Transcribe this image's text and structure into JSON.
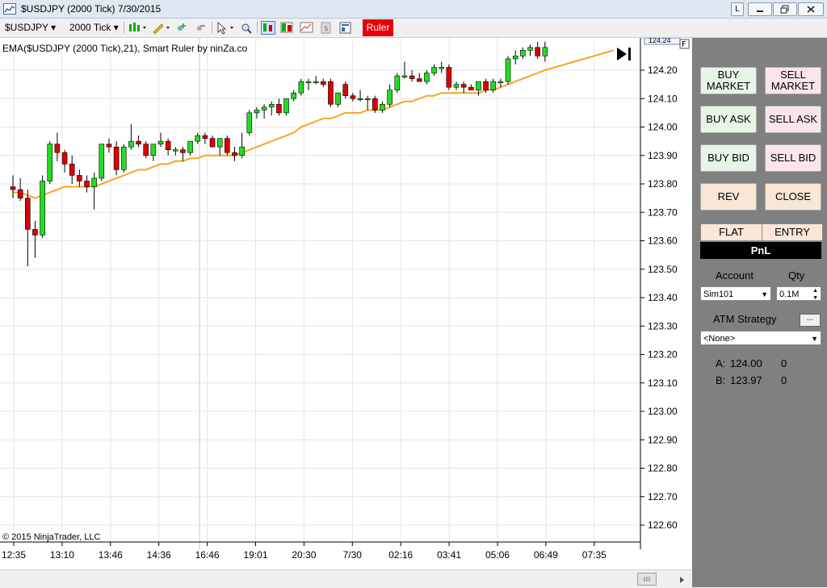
{
  "window": {
    "title": "$USDJPY (2000 Tick)  7/30/2015",
    "btn_l": "L"
  },
  "toolbar": {
    "instrument": "$USDJPY",
    "interval": "2000 Tick",
    "ruler_label": "Ruler"
  },
  "chart": {
    "indicator_label": "EMA($USDJPY (2000 Tick),21), Smart Ruler by ninZa.co",
    "copyright": "© 2015 NinjaTrader, LLC",
    "price_labels": [
      "124.20",
      "124.10",
      "124.00",
      "123.90",
      "123.80",
      "123.70",
      "123.60",
      "123.50",
      "123.40",
      "123.30",
      "123.20",
      "123.10",
      "123.00",
      "122.90",
      "122.80",
      "122.70",
      "122.60"
    ],
    "time_labels": [
      "12:35",
      "13:10",
      "13:46",
      "14:36",
      "16:46",
      "19:01",
      "20:30",
      "7/30",
      "02:16",
      "03:41",
      "05:06",
      "06:49",
      "07:35"
    ],
    "current_price": "124.24",
    "colors": {
      "up": "#22dd22",
      "down": "#dd0000",
      "ema": "#f5a623"
    },
    "candles": [
      {
        "o": 123.79,
        "h": 123.83,
        "l": 123.75,
        "c": 123.78
      },
      {
        "o": 123.78,
        "h": 123.82,
        "l": 123.74,
        "c": 123.75
      },
      {
        "o": 123.75,
        "h": 123.78,
        "l": 123.51,
        "c": 123.64
      },
      {
        "o": 123.64,
        "h": 123.67,
        "l": 123.54,
        "c": 123.62
      },
      {
        "o": 123.62,
        "h": 123.83,
        "l": 123.61,
        "c": 123.81
      },
      {
        "o": 123.81,
        "h": 123.95,
        "l": 123.8,
        "c": 123.94
      },
      {
        "o": 123.94,
        "h": 123.98,
        "l": 123.88,
        "c": 123.91
      },
      {
        "o": 123.91,
        "h": 123.92,
        "l": 123.84,
        "c": 123.87
      },
      {
        "o": 123.87,
        "h": 123.9,
        "l": 123.8,
        "c": 123.83
      },
      {
        "o": 123.83,
        "h": 123.85,
        "l": 123.79,
        "c": 123.81
      },
      {
        "o": 123.81,
        "h": 123.83,
        "l": 123.77,
        "c": 123.79
      },
      {
        "o": 123.79,
        "h": 123.84,
        "l": 123.71,
        "c": 123.82
      },
      {
        "o": 123.82,
        "h": 123.94,
        "l": 123.81,
        "c": 123.94
      },
      {
        "o": 123.94,
        "h": 123.96,
        "l": 123.91,
        "c": 123.93
      },
      {
        "o": 123.93,
        "h": 123.95,
        "l": 123.83,
        "c": 123.85
      },
      {
        "o": 123.85,
        "h": 123.94,
        "l": 123.84,
        "c": 123.93
      },
      {
        "o": 123.93,
        "h": 124.01,
        "l": 123.92,
        "c": 123.95
      },
      {
        "o": 123.95,
        "h": 123.97,
        "l": 123.93,
        "c": 123.94
      },
      {
        "o": 123.94,
        "h": 123.95,
        "l": 123.89,
        "c": 123.9
      },
      {
        "o": 123.9,
        "h": 123.94,
        "l": 123.88,
        "c": 123.94
      },
      {
        "o": 123.94,
        "h": 123.98,
        "l": 123.93,
        "c": 123.95
      },
      {
        "o": 123.95,
        "h": 123.96,
        "l": 123.9,
        "c": 123.92
      },
      {
        "o": 123.92,
        "h": 123.93,
        "l": 123.9,
        "c": 123.92
      },
      {
        "o": 123.92,
        "h": 123.93,
        "l": 123.88,
        "c": 123.91
      },
      {
        "o": 123.91,
        "h": 123.95,
        "l": 123.9,
        "c": 123.95
      },
      {
        "o": 123.95,
        "h": 123.98,
        "l": 123.94,
        "c": 123.97
      },
      {
        "o": 123.97,
        "h": 123.98,
        "l": 123.94,
        "c": 123.96
      },
      {
        "o": 123.96,
        "h": 123.97,
        "l": 123.93,
        "c": 123.93
      },
      {
        "o": 123.93,
        "h": 123.96,
        "l": 123.9,
        "c": 123.96
      },
      {
        "o": 123.96,
        "h": 123.97,
        "l": 123.9,
        "c": 123.91
      },
      {
        "o": 123.91,
        "h": 123.93,
        "l": 123.88,
        "c": 123.9
      },
      {
        "o": 123.9,
        "h": 123.98,
        "l": 123.89,
        "c": 123.93
      },
      {
        "o": 123.98,
        "h": 124.06,
        "l": 123.97,
        "c": 124.05
      },
      {
        "o": 124.05,
        "h": 124.07,
        "l": 124.03,
        "c": 124.06
      },
      {
        "o": 124.06,
        "h": 124.08,
        "l": 124.03,
        "c": 124.07
      },
      {
        "o": 124.07,
        "h": 124.09,
        "l": 124.04,
        "c": 124.08
      },
      {
        "o": 124.08,
        "h": 124.1,
        "l": 124.04,
        "c": 124.05
      },
      {
        "o": 124.05,
        "h": 124.1,
        "l": 124.04,
        "c": 124.1
      },
      {
        "o": 124.1,
        "h": 124.13,
        "l": 124.09,
        "c": 124.12
      },
      {
        "o": 124.12,
        "h": 124.17,
        "l": 124.11,
        "c": 124.16
      },
      {
        "o": 124.16,
        "h": 124.17,
        "l": 124.13,
        "c": 124.16
      },
      {
        "o": 124.16,
        "h": 124.18,
        "l": 124.15,
        "c": 124.16
      },
      {
        "o": 124.16,
        "h": 124.17,
        "l": 124.14,
        "c": 124.15
      },
      {
        "o": 124.16,
        "h": 124.17,
        "l": 124.07,
        "c": 124.08
      },
      {
        "o": 124.08,
        "h": 124.12,
        "l": 124.07,
        "c": 124.12
      },
      {
        "o": 124.15,
        "h": 124.16,
        "l": 124.1,
        "c": 124.11
      },
      {
        "o": 124.11,
        "h": 124.12,
        "l": 124.09,
        "c": 124.1
      },
      {
        "o": 124.1,
        "h": 124.13,
        "l": 124.09,
        "c": 124.1
      },
      {
        "o": 124.1,
        "h": 124.11,
        "l": 124.06,
        "c": 124.1
      },
      {
        "o": 124.1,
        "h": 124.11,
        "l": 124.05,
        "c": 124.06
      },
      {
        "o": 124.06,
        "h": 124.09,
        "l": 124.05,
        "c": 124.08
      },
      {
        "o": 124.08,
        "h": 124.15,
        "l": 124.07,
        "c": 124.13
      },
      {
        "o": 124.13,
        "h": 124.19,
        "l": 124.12,
        "c": 124.18
      },
      {
        "o": 124.18,
        "h": 124.23,
        "l": 124.17,
        "c": 124.18
      },
      {
        "o": 124.18,
        "h": 124.2,
        "l": 124.16,
        "c": 124.17
      },
      {
        "o": 124.17,
        "h": 124.19,
        "l": 124.16,
        "c": 124.16
      },
      {
        "o": 124.16,
        "h": 124.2,
        "l": 124.15,
        "c": 124.19
      },
      {
        "o": 124.19,
        "h": 124.22,
        "l": 124.18,
        "c": 124.21
      },
      {
        "o": 124.21,
        "h": 124.23,
        "l": 124.19,
        "c": 124.21
      },
      {
        "o": 124.21,
        "h": 124.22,
        "l": 124.13,
        "c": 124.14
      },
      {
        "o": 124.14,
        "h": 124.16,
        "l": 124.13,
        "c": 124.15
      },
      {
        "o": 124.15,
        "h": 124.16,
        "l": 124.12,
        "c": 124.14
      },
      {
        "o": 124.14,
        "h": 124.15,
        "l": 124.13,
        "c": 124.13
      },
      {
        "o": 124.13,
        "h": 124.16,
        "l": 124.11,
        "c": 124.16
      },
      {
        "o": 124.16,
        "h": 124.17,
        "l": 124.12,
        "c": 124.13
      },
      {
        "o": 124.13,
        "h": 124.17,
        "l": 124.12,
        "c": 124.16
      },
      {
        "o": 124.16,
        "h": 124.17,
        "l": 124.14,
        "c": 124.16
      },
      {
        "o": 124.16,
        "h": 124.25,
        "l": 124.15,
        "c": 124.24
      },
      {
        "o": 124.24,
        "h": 124.27,
        "l": 124.22,
        "c": 124.25
      },
      {
        "o": 124.25,
        "h": 124.28,
        "l": 124.24,
        "c": 124.27
      },
      {
        "o": 124.27,
        "h": 124.29,
        "l": 124.25,
        "c": 124.28
      },
      {
        "o": 124.28,
        "h": 124.3,
        "l": 124.24,
        "c": 124.25
      },
      {
        "o": 124.25,
        "h": 124.3,
        "l": 124.23,
        "c": 124.28
      }
    ],
    "ema": [
      123.77,
      123.77,
      123.76,
      123.75,
      123.76,
      123.77,
      123.78,
      123.79,
      123.79,
      123.79,
      123.79,
      123.79,
      123.8,
      123.81,
      123.82,
      123.83,
      123.84,
      123.85,
      123.85,
      123.86,
      123.87,
      123.87,
      123.88,
      123.88,
      123.89,
      123.89,
      123.9,
      123.9,
      123.9,
      123.9,
      123.9,
      123.91,
      123.92,
      123.93,
      123.94,
      123.95,
      123.96,
      123.97,
      123.98,
      124.0,
      124.01,
      124.02,
      124.03,
      124.03,
      124.04,
      124.05,
      124.05,
      124.05,
      124.06,
      124.06,
      124.06,
      124.07,
      124.08,
      124.09,
      124.09,
      124.1,
      124.11,
      124.11,
      124.12,
      124.12,
      124.12,
      124.12,
      124.12,
      124.12,
      124.13,
      124.13,
      124.14,
      124.15,
      124.16,
      124.17,
      124.18,
      124.19,
      124.2
    ]
  },
  "panel": {
    "buy_market": "BUY MARKET",
    "sell_market": "SELL MARKET",
    "buy_ask": "BUY ASK",
    "sell_ask": "SELL ASK",
    "buy_bid": "BUY BID",
    "sell_bid": "SELL BID",
    "rev": "REV",
    "close": "CLOSE",
    "flat": "FLAT",
    "entry": "ENTRY",
    "pnl": "PnL",
    "account_label": "Account",
    "qty_label": "Qty",
    "account_value": "Sim101",
    "qty_value": "0.1M",
    "atm_label": "ATM Strategy",
    "atm_button": "...",
    "atm_value": "<None>",
    "ask_label": "A:",
    "ask_price": "124.00",
    "ask_size": "0",
    "bid_label": "B:",
    "bid_price": "123.97",
    "bid_size": "0"
  }
}
